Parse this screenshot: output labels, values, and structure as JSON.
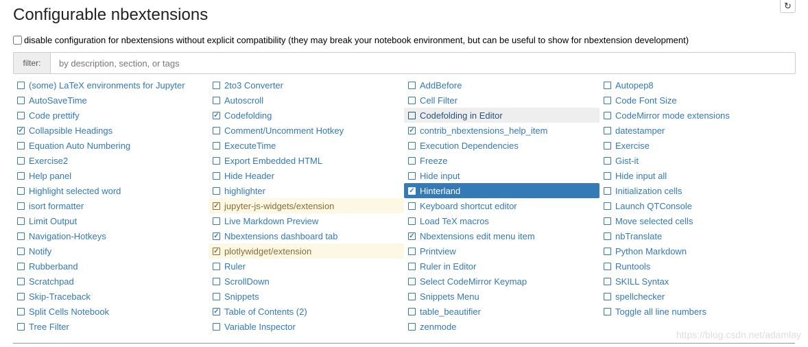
{
  "header": {
    "title": "Configurable nbextensions",
    "refresh_icon": "refresh-icon"
  },
  "compat": {
    "label": "disable configuration for nbextensions without explicit compatibility (they may break your notebook environment, but can be useful to show for nbextension development)",
    "checked": false
  },
  "filter": {
    "label": "filter:",
    "placeholder": "by description, section, or tags",
    "value": ""
  },
  "colors": {
    "link": "#337ab7",
    "selected_bg": "#337ab7",
    "warning_bg": "#fcf8e3",
    "warning_text": "#8a6d3b",
    "hover_bg": "#eeeeee"
  },
  "extensions": [
    {
      "label": "(some) LaTeX environments for Jupyter",
      "checked": false
    },
    {
      "label": "2to3 Converter",
      "checked": false
    },
    {
      "label": "AddBefore",
      "checked": false
    },
    {
      "label": "Autopep8",
      "checked": false
    },
    {
      "label": "AutoSaveTime",
      "checked": false
    },
    {
      "label": "Autoscroll",
      "checked": false
    },
    {
      "label": "Cell Filter",
      "checked": false
    },
    {
      "label": "Code Font Size",
      "checked": false
    },
    {
      "label": "Code prettify",
      "checked": false
    },
    {
      "label": "Codefolding",
      "checked": true
    },
    {
      "label": "Codefolding in Editor",
      "checked": false,
      "state": "hover"
    },
    {
      "label": "CodeMirror mode extensions",
      "checked": false
    },
    {
      "label": "Collapsible Headings",
      "checked": true
    },
    {
      "label": "Comment/Uncomment Hotkey",
      "checked": false
    },
    {
      "label": "contrib_nbextensions_help_item",
      "checked": true
    },
    {
      "label": "datestamper",
      "checked": false
    },
    {
      "label": "Equation Auto Numbering",
      "checked": false
    },
    {
      "label": "ExecuteTime",
      "checked": false
    },
    {
      "label": "Execution Dependencies",
      "checked": false
    },
    {
      "label": "Exercise",
      "checked": false
    },
    {
      "label": "Exercise2",
      "checked": false
    },
    {
      "label": "Export Embedded HTML",
      "checked": false
    },
    {
      "label": "Freeze",
      "checked": false
    },
    {
      "label": "Gist-it",
      "checked": false
    },
    {
      "label": "Help panel",
      "checked": false
    },
    {
      "label": "Hide Header",
      "checked": false
    },
    {
      "label": "Hide input",
      "checked": false
    },
    {
      "label": "Hide input all",
      "checked": false
    },
    {
      "label": "Highlight selected word",
      "checked": false
    },
    {
      "label": "highlighter",
      "checked": false
    },
    {
      "label": "Hinterland",
      "checked": true,
      "state": "selected"
    },
    {
      "label": "Initialization cells",
      "checked": false
    },
    {
      "label": "isort formatter",
      "checked": false
    },
    {
      "label": "jupyter-js-widgets/extension",
      "checked": true,
      "state": "warning"
    },
    {
      "label": "Keyboard shortcut editor",
      "checked": false
    },
    {
      "label": "Launch QTConsole",
      "checked": false
    },
    {
      "label": "Limit Output",
      "checked": false
    },
    {
      "label": "Live Markdown Preview",
      "checked": false
    },
    {
      "label": "Load TeX macros",
      "checked": false
    },
    {
      "label": "Move selected cells",
      "checked": false
    },
    {
      "label": "Navigation-Hotkeys",
      "checked": false
    },
    {
      "label": "Nbextensions dashboard tab",
      "checked": true
    },
    {
      "label": "Nbextensions edit menu item",
      "checked": true
    },
    {
      "label": "nbTranslate",
      "checked": false
    },
    {
      "label": "Notify",
      "checked": false
    },
    {
      "label": "plotlywidget/extension",
      "checked": true,
      "state": "warning"
    },
    {
      "label": "Printview",
      "checked": false
    },
    {
      "label": "Python Markdown",
      "checked": false
    },
    {
      "label": "Rubberband",
      "checked": false
    },
    {
      "label": "Ruler",
      "checked": false
    },
    {
      "label": "Ruler in Editor",
      "checked": false
    },
    {
      "label": "Runtools",
      "checked": false
    },
    {
      "label": "Scratchpad",
      "checked": false
    },
    {
      "label": "ScrollDown",
      "checked": false
    },
    {
      "label": "Select CodeMirror Keymap",
      "checked": false
    },
    {
      "label": "SKILL Syntax",
      "checked": false
    },
    {
      "label": "Skip-Traceback",
      "checked": false
    },
    {
      "label": "Snippets",
      "checked": false
    },
    {
      "label": "Snippets Menu",
      "checked": false
    },
    {
      "label": "spellchecker",
      "checked": false
    },
    {
      "label": "Split Cells Notebook",
      "checked": false
    },
    {
      "label": "Table of Contents (2)",
      "checked": true
    },
    {
      "label": "table_beautifier",
      "checked": false
    },
    {
      "label": "Toggle all line numbers",
      "checked": false
    },
    {
      "label": "Tree Filter",
      "checked": false
    },
    {
      "label": "Variable Inspector",
      "checked": false
    },
    {
      "label": "zenmode",
      "checked": false
    }
  ],
  "watermark": "https://blog.csdn.net/adamlay"
}
